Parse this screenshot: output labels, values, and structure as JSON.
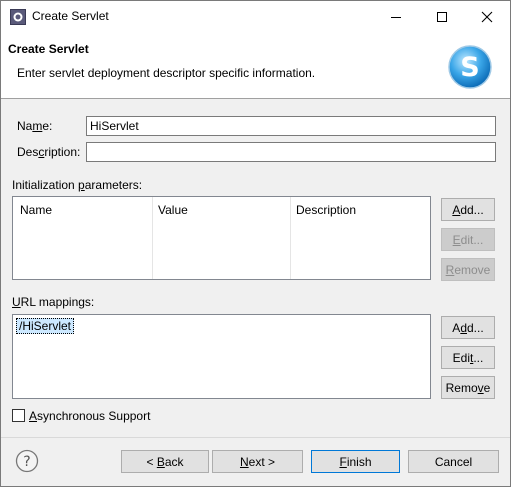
{
  "window": {
    "title": "Create Servlet"
  },
  "banner": {
    "title": "Create Servlet",
    "description": "Enter servlet deployment descriptor specific information.",
    "logo_icon": "servlet-s-logo-icon"
  },
  "form": {
    "name_label_pre": "Na",
    "name_label_u": "m",
    "name_label_post": "e:",
    "name_value": "HiServlet",
    "description_label_pre": "Des",
    "description_label_u": "c",
    "description_label_post": "ription:",
    "description_value": ""
  },
  "init_params": {
    "label_pre": "Initialization ",
    "label_u": "p",
    "label_post": "arameters:",
    "columns": [
      "Name",
      "Value",
      "Description"
    ],
    "buttons": {
      "add_pre": "",
      "add_u": "A",
      "add_post": "dd...",
      "edit_pre": "",
      "edit_u": "E",
      "edit_post": "dit...",
      "remove_pre": "",
      "remove_u": "R",
      "remove_post": "emove"
    }
  },
  "url_mappings": {
    "label_pre": "",
    "label_u": "U",
    "label_post": "RL mappings:",
    "items": [
      "/HiServlet"
    ],
    "buttons": {
      "add_pre": "A",
      "add_u": "d",
      "add_post": "d...",
      "edit_pre": "Edi",
      "edit_u": "t",
      "edit_post": "...",
      "remove_pre": "Remo",
      "remove_u": "v",
      "remove_post": "e"
    }
  },
  "async": {
    "label_pre": "",
    "label_u": "A",
    "label_post": "synchronous Support",
    "checked": false
  },
  "footer": {
    "back_pre": "< ",
    "back_u": "B",
    "back_post": "ack",
    "next_pre": "",
    "next_u": "N",
    "next_post": "ext >",
    "finish_pre": "",
    "finish_u": "F",
    "finish_post": "inish",
    "cancel": "Cancel",
    "help_icon": "help-question-icon"
  },
  "colors": {
    "accent": "#0078d7",
    "window_bg": "#f0f0f0",
    "selection": "#cce8ff"
  }
}
